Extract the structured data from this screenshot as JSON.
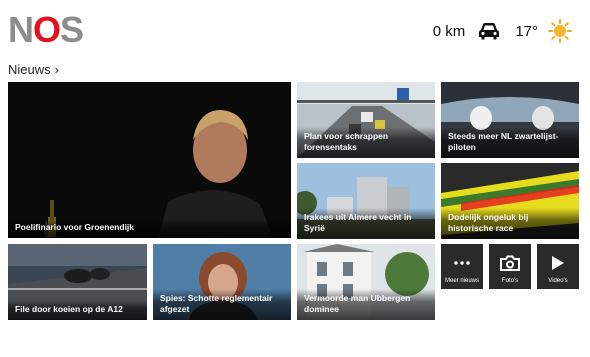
{
  "header": {
    "logo_letters": [
      "N",
      "O",
      "S"
    ],
    "distance": "0 km",
    "temperature": "17°",
    "car_icon": "car-icon",
    "weather_icon": "sun-icon"
  },
  "section": {
    "title": "Nieuws",
    "chevron": "›"
  },
  "tiles": [
    {
      "caption": "Poelifinario voor Groenendijk"
    },
    {
      "caption": "Plan voor schrappen forensentaks"
    },
    {
      "caption": "Steeds meer NL zwartelijst-piloten"
    },
    {
      "caption": "Irakees uit Almere vecht in Syrië"
    },
    {
      "caption": "Dodelijk ongeluk bij historische race"
    },
    {
      "caption": "File door koeien op de A12"
    },
    {
      "caption": "Spies: Schotte reglementair afgezet"
    },
    {
      "caption": "Vermoorde man Ubbergen dominee"
    }
  ],
  "buttons": [
    {
      "label": "Meer nieuws",
      "icon": "more-icon"
    },
    {
      "label": "Foto's",
      "icon": "camera-icon"
    },
    {
      "label": "Video's",
      "icon": "play-icon"
    }
  ],
  "colors": {
    "brand_red": "#e1121d",
    "logo_grey": "#8c8c8c",
    "button_bg": "#2a2a2a"
  }
}
